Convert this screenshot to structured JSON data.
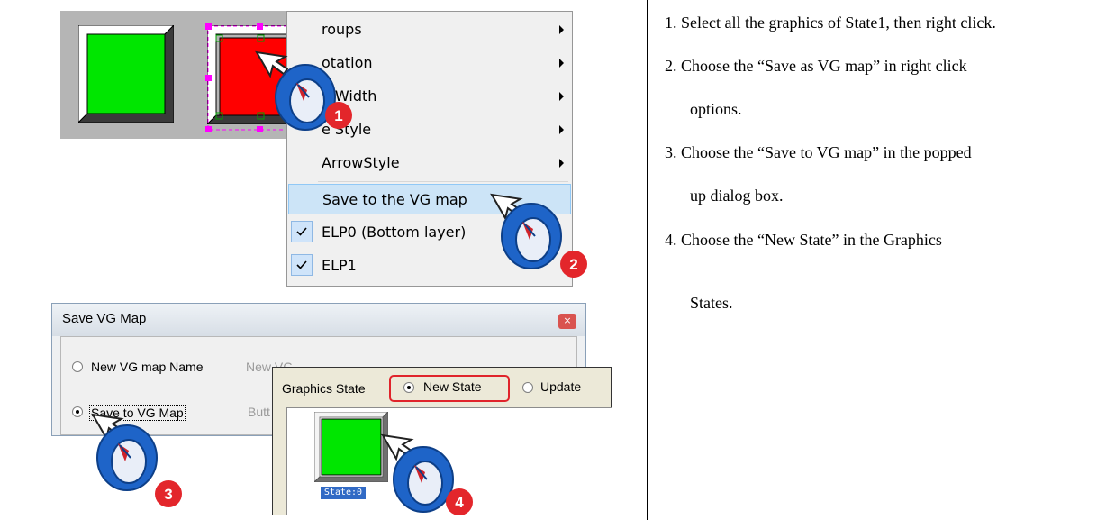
{
  "context_menu": {
    "items": [
      {
        "label": "roups",
        "submenu": true
      },
      {
        "label": "otation",
        "submenu": true
      },
      {
        "label": "e Width",
        "submenu": true
      },
      {
        "label": "e Style",
        "submenu": true
      },
      {
        "label": "ArrowStyle",
        "submenu": true
      },
      {
        "label": "Save to the VG map",
        "highlighted": true
      },
      {
        "label": "ELP0 (Bottom layer)",
        "checked": true
      },
      {
        "label": "ELP1",
        "checked": true
      }
    ]
  },
  "dialog": {
    "title": "Save VG Map",
    "close_label": "×",
    "options": {
      "new_name_label": "New VG map Name",
      "new_name_value": "New VG",
      "save_to_label": "Save to VG Map",
      "save_to_value": "Butt"
    }
  },
  "graphics_state": {
    "label": "Graphics State",
    "new_state": "New State",
    "update": "Update",
    "state_item": "State:0"
  },
  "callouts": [
    "1",
    "2",
    "3",
    "4"
  ],
  "instructions": [
    "1. Select all the graphics of State1, then right click.",
    "2. Choose the  “Save as VG map”  in right click",
    "options.",
    "3. Choose the  “Save to VG map”  in the popped",
    "up dialog box.",
    "4.  Choose  the   “New State”   in  the  Graphics",
    "States."
  ],
  "colors": {
    "green": "#00e600",
    "red": "#ff0000",
    "selection": "#ff00ff",
    "menu_highlight": "#cce4f7",
    "callout_red": "#e3262b",
    "cursor_blue": "#1e64c8"
  }
}
